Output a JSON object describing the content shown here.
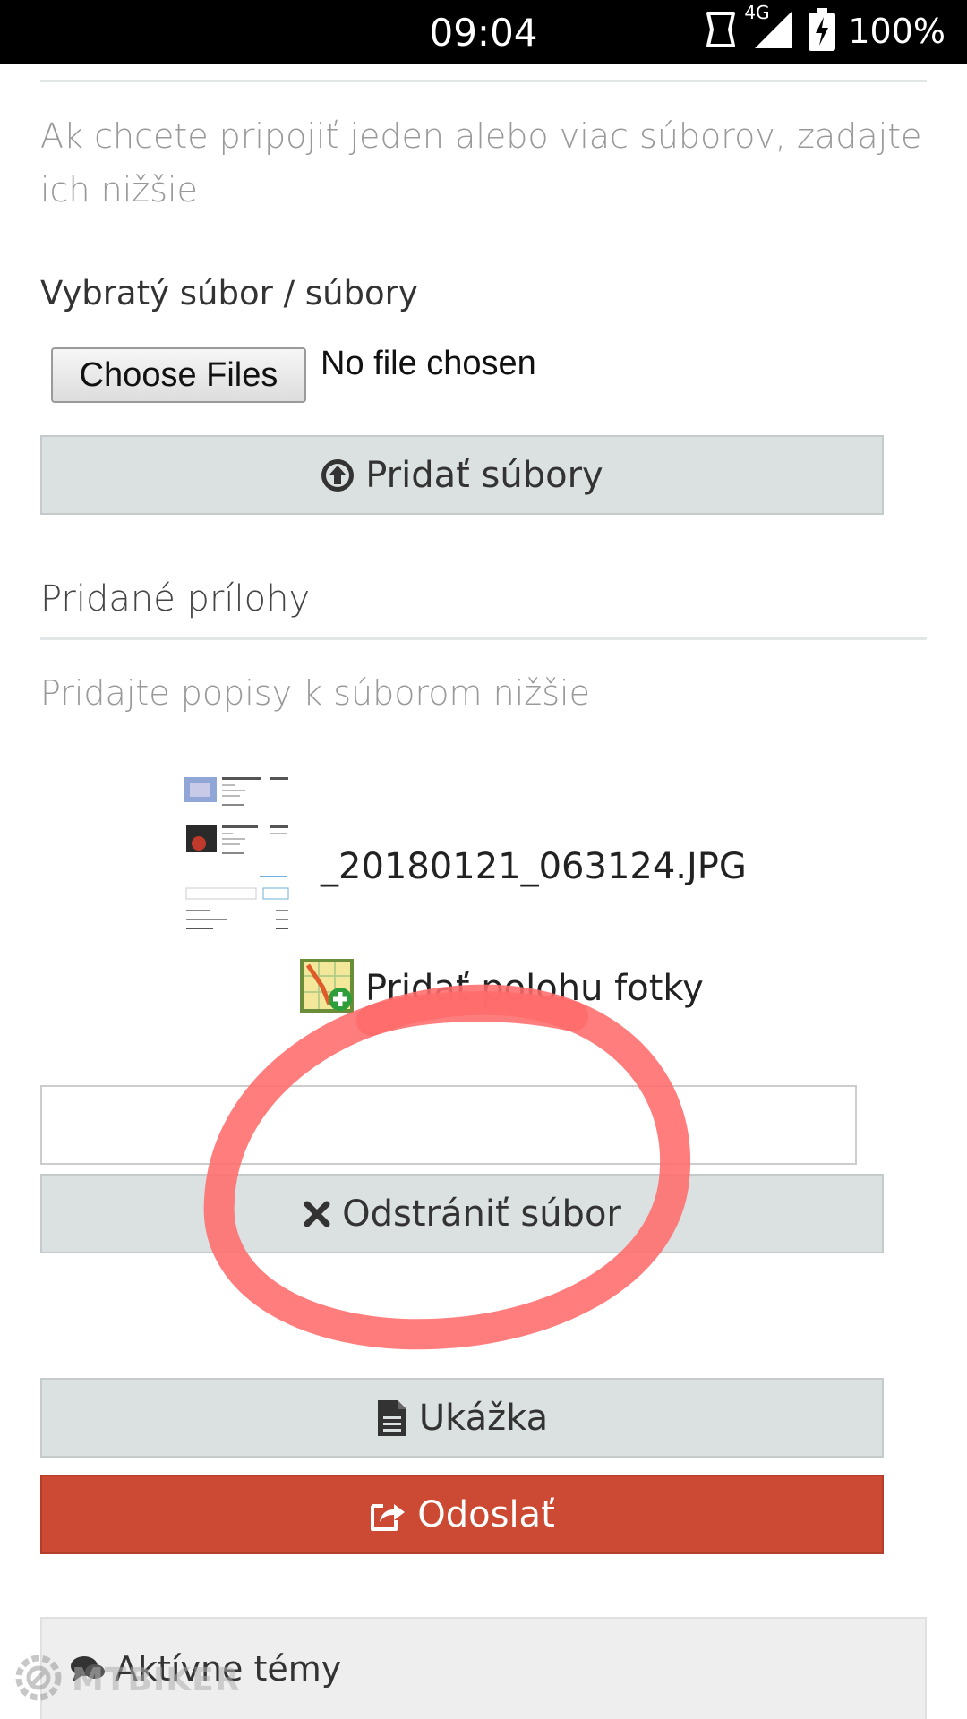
{
  "status_bar": {
    "time": "09:04",
    "network": "4G",
    "battery": "100%"
  },
  "attachments": {
    "intro_text": "Ak chcete pripojiť jeden alebo viac súborov, zadajte ich nižšie",
    "selected_label": "Vybratý súbor / súbory",
    "choose_files_label": "Choose Files",
    "file_status": "No file chosen",
    "add_files_label": "Pridať súbory",
    "added_heading": "Pridané prílohy",
    "describe_hint": "Pridajte popisy k súborom nižšie",
    "file_name": "_20180121_063124.JPG",
    "add_location_label": "Pridať polohu fotky",
    "description_value": "",
    "remove_file_label": "Odstrániť súbor"
  },
  "actions": {
    "preview_label": "Ukážka",
    "submit_label": "Odoslať"
  },
  "panel": {
    "title": "Aktívne témy"
  },
  "watermark": {
    "text": "MTBIKER"
  },
  "colors": {
    "gray_button": "#dbe0e0",
    "submit_button": "#cc4933",
    "annotation": "#ff6b6b"
  },
  "icons": {
    "add_files": "upload-circle-icon",
    "add_location": "map-pin-icon",
    "remove_file": "times-icon",
    "preview": "document-icon",
    "submit": "share-icon",
    "panel": "comments-icon"
  }
}
